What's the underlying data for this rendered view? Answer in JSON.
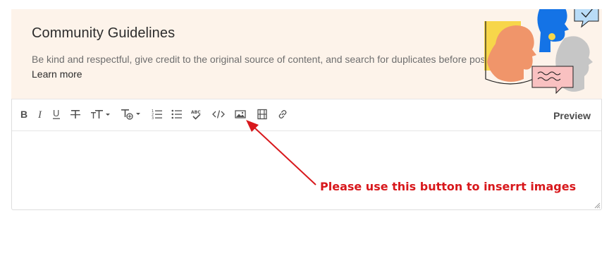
{
  "guidelines": {
    "title": "Community Guidelines",
    "description": "Be kind and respectful, give credit to the original source of content, and search for duplicates before posting.",
    "link": "Learn more"
  },
  "toolbar": {
    "buttons": [
      {
        "name": "bold-button",
        "icon": "bold-icon"
      },
      {
        "name": "italic-button",
        "icon": "italic-icon"
      },
      {
        "name": "underline-button",
        "icon": "underline-icon"
      },
      {
        "name": "strikethrough-button",
        "icon": "strikethrough-icon"
      },
      {
        "name": "font-size-button",
        "icon": "font-size-icon"
      },
      {
        "name": "text-format-button",
        "icon": "text-format-icon"
      },
      {
        "name": "numbered-list-button",
        "icon": "numbered-list-icon"
      },
      {
        "name": "bullet-list-button",
        "icon": "bullet-list-icon"
      },
      {
        "name": "spellcheck-button",
        "icon": "spellcheck-icon"
      },
      {
        "name": "code-button",
        "icon": "code-icon"
      },
      {
        "name": "insert-image-button",
        "icon": "image-icon"
      },
      {
        "name": "insert-video-button",
        "icon": "video-icon"
      },
      {
        "name": "insert-link-button",
        "icon": "link-icon"
      }
    ],
    "preview_label": "Preview"
  },
  "annotation": {
    "text": "Please use this button to inserrt images",
    "color": "#d8181c"
  },
  "colors": {
    "banner_bg": "#fdf3ea",
    "illustration_yellow": "#f7d64a",
    "illustration_orange": "#f0956a",
    "illustration_blue": "#1473e6",
    "illustration_gray": "#c6c6c6",
    "illustration_pink": "#f9c1c1",
    "illustration_lightblue": "#b9dcf7"
  }
}
